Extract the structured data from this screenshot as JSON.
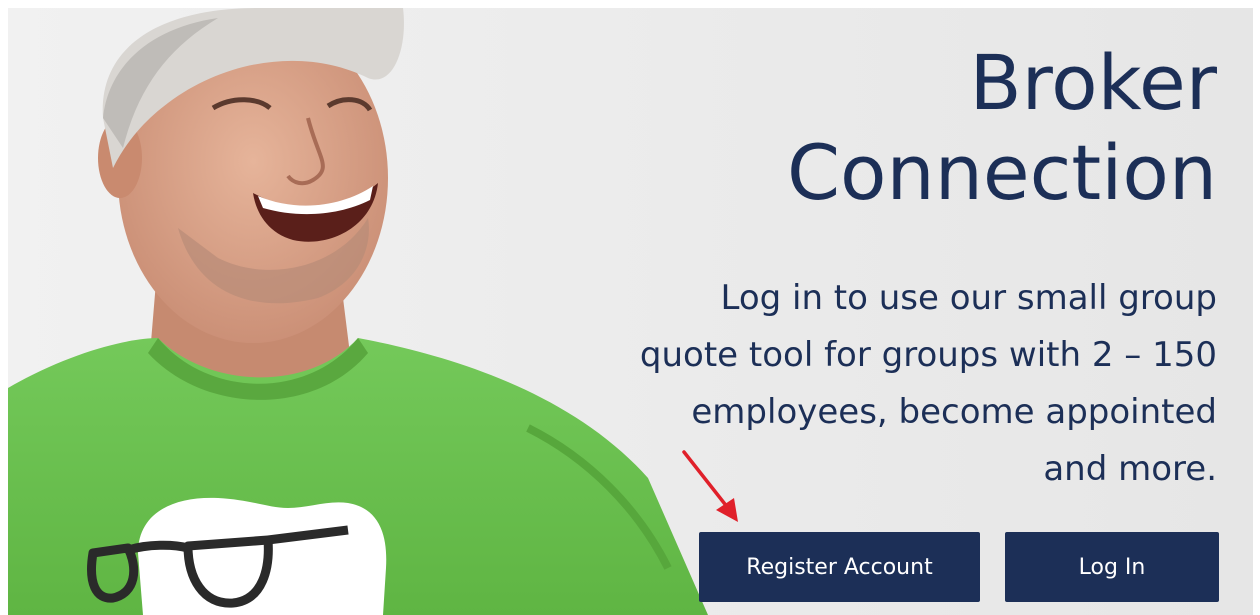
{
  "hero": {
    "title_lines": [
      "Broker",
      "Connection"
    ],
    "description_lines": [
      "Log in to use our small group",
      "quote tool for groups with 2 – 150",
      "employees, become appointed",
      "and more."
    ]
  },
  "buttons": {
    "register_label": "Register Account",
    "login_label": "Log In"
  },
  "colors": {
    "brand_navy": "#1c2f57",
    "shirt_green": "#6cc24a",
    "annotation_arrow": "#e0202a"
  },
  "icons": {
    "annotation": "arrow-pointing-register-button",
    "photo": "smiling-man-green-shirt-glasses-logo"
  }
}
